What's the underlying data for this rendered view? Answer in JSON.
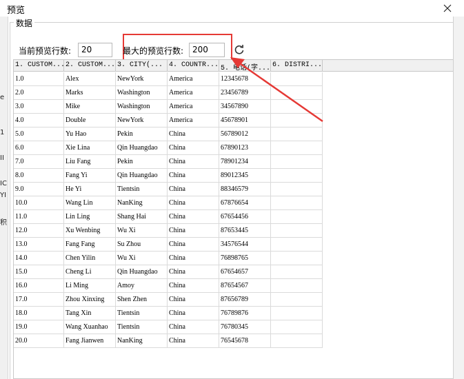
{
  "window": {
    "title": "预览"
  },
  "left_strip": [
    "e",
    "1",
    "II",
    "IC",
    "YI",
    "积"
  ],
  "group": {
    "legend": "数据"
  },
  "controls": {
    "current_rows_label": "当前预览行数:",
    "current_rows_value": "20",
    "max_rows_label": "最大的预览行数:",
    "max_rows_value": "200"
  },
  "grid": {
    "headers": [
      "1. CUSTOM...",
      "2. CUSTOM...",
      "3. CITY(...",
      "4. COUNTR...",
      "5. 电话(字...",
      "6. DISTRI..."
    ],
    "rows": [
      [
        "1.0",
        "Alex",
        "NewYork",
        "America",
        "12345678",
        ""
      ],
      [
        "2.0",
        "Marks",
        "Washington",
        "America",
        "23456789",
        ""
      ],
      [
        "3.0",
        "Mike",
        "Washington",
        "America",
        "34567890",
        ""
      ],
      [
        "4.0",
        "Double",
        "NewYork",
        "America",
        "45678901",
        ""
      ],
      [
        "5.0",
        "Yu Hao",
        "Pekin",
        "China",
        "56789012",
        ""
      ],
      [
        "6.0",
        "Xie Lina",
        "Qin Huangdao",
        "China",
        "67890123",
        ""
      ],
      [
        "7.0",
        "Liu Fang",
        "Pekin",
        "China",
        "78901234",
        ""
      ],
      [
        "8.0",
        "Fang Yi",
        "Qin Huangdao",
        "China",
        "89012345",
        ""
      ],
      [
        "9.0",
        "He Yi",
        "Tientsin",
        "China",
        "88346579",
        ""
      ],
      [
        "10.0",
        "Wang Lin",
        "NanKing",
        "China",
        "67876654",
        ""
      ],
      [
        "11.0",
        "Lin Ling",
        "Shang Hai",
        "China",
        "67654456",
        ""
      ],
      [
        "12.0",
        "Xu Wenbing",
        "Wu Xi",
        "China",
        "87653445",
        ""
      ],
      [
        "13.0",
        "Fang Fang",
        "Su Zhou",
        "China",
        "34576544",
        ""
      ],
      [
        "14.0",
        "Chen Yilin",
        "Wu Xi",
        "China",
        "76898765",
        ""
      ],
      [
        "15.0",
        "Cheng Li",
        "Qin Huangdao",
        "China",
        "67654657",
        ""
      ],
      [
        "16.0",
        "Li Ming",
        "Amoy",
        "China",
        "87654567",
        ""
      ],
      [
        "17.0",
        "Zhou Xinxing",
        "Shen Zhen",
        "China",
        "87656789",
        ""
      ],
      [
        "18.0",
        "Tang Xin",
        "Tientsin",
        "China",
        "76789876",
        ""
      ],
      [
        "19.0",
        "Wang Xuanhao",
        "Tientsin",
        "China",
        "76780345",
        ""
      ],
      [
        "20.0",
        "Fang Jianwen",
        "NanKing",
        "China",
        "76545678",
        ""
      ]
    ]
  },
  "icons": {
    "close": "close-icon",
    "refresh": "refresh-icon"
  },
  "colors": {
    "highlight": "#e53935",
    "border": "#c8c8c8",
    "header_bg": "#f0f0f0"
  }
}
